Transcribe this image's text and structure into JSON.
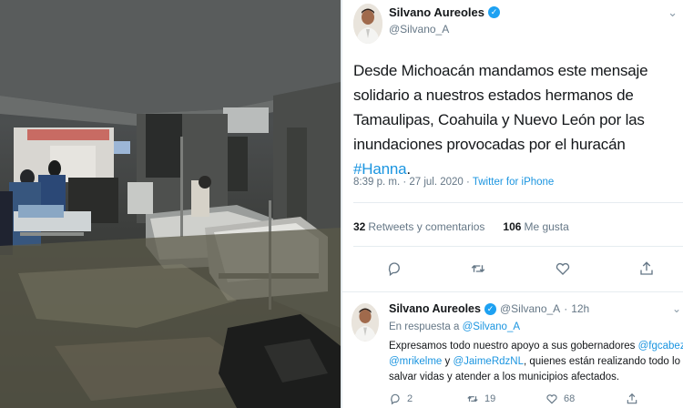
{
  "photo": {
    "description_icon": "flooded-hospital-photo-icon"
  },
  "main_tweet": {
    "author_name": "Silvano Aureoles",
    "author_handle": "@Silvano_A",
    "text_before": "Desde Michoacán mandamos este mensaje solidario a nuestros estados hermanos de Tamaulipas, Coahuila y Nuevo León por las inundaciones provocadas por el huracán ",
    "hashtag": "#Hanna",
    "text_after": ".",
    "time": "8:39 p. m. · 27 jul. 2020 · ",
    "source": "Twitter for iPhone",
    "retweets_count": "32",
    "retweets_label": "Retweets y comentarios",
    "likes_count": "106",
    "likes_label": "Me gusta"
  },
  "reply_tweet": {
    "author_name": "Silvano Aureoles",
    "author_handle": "@Silvano_A",
    "separator": "·",
    "time": "12h",
    "replying_label": "En respuesta a ",
    "replying_to": "@Silvano_A",
    "line1_text": "Expresamos todo nuestro apoyo a sus gobernadores ",
    "mention1": "@fgcabezadevaca",
    "line1_end": ",",
    "mention2": "@mrikelme",
    "line2_mid": " y ",
    "mention3": "@JaimeRdzNL",
    "line2_end": ", quienes están realizando todo lo necesario para",
    "line3_text": "salvar vidas y atender a los municipios afectados.",
    "reply_count": "2",
    "retweet_count": "19",
    "like_count": "68"
  },
  "colors": {
    "accent": "#1b95e0",
    "verified": "#1da1f2",
    "muted": "#657786"
  }
}
